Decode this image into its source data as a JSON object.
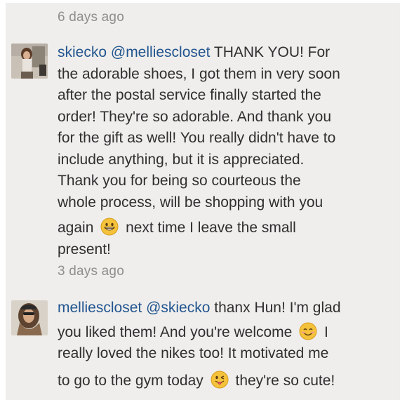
{
  "comments": [
    {
      "timestamp_above": "6 days ago",
      "username": "skiecko",
      "mention": "@melliescloset",
      "text_lines": [
        " THANK YOU! For",
        "the adorable shoes, I got them in very soon",
        "after the postal service finally started the",
        "order! They're so adorable. And thank you",
        "for the gift as well! You really didn't have to",
        "include anything, but it is appreciated.",
        "Thank you for being so courteous the",
        "whole process, will be shopping with you"
      ],
      "line_again_before": "again",
      "line_again_after": "next time I leave the small",
      "last_line": "present!",
      "timestamp": "3 days ago"
    },
    {
      "username": "melliescloset",
      "mention": "@skiecko",
      "line1_rest": " thanx Hun! I'm glad",
      "line2_before": "you liked them! And you're welcome",
      "line2_after": "I",
      "line3": "really loved the nikes too! It motivated me",
      "line4_before": "to go to the gym today",
      "line4_after": "they're so cute!"
    }
  ],
  "icons": {
    "grin": "grinning-face-emoji",
    "smile": "smiling-face-emoji",
    "wink": "winking-tongue-face-emoji"
  },
  "colors": {
    "background": "#efeeec",
    "link": "#22558f",
    "text": "#2f2f2f",
    "timestamp": "#8e8e8e"
  }
}
